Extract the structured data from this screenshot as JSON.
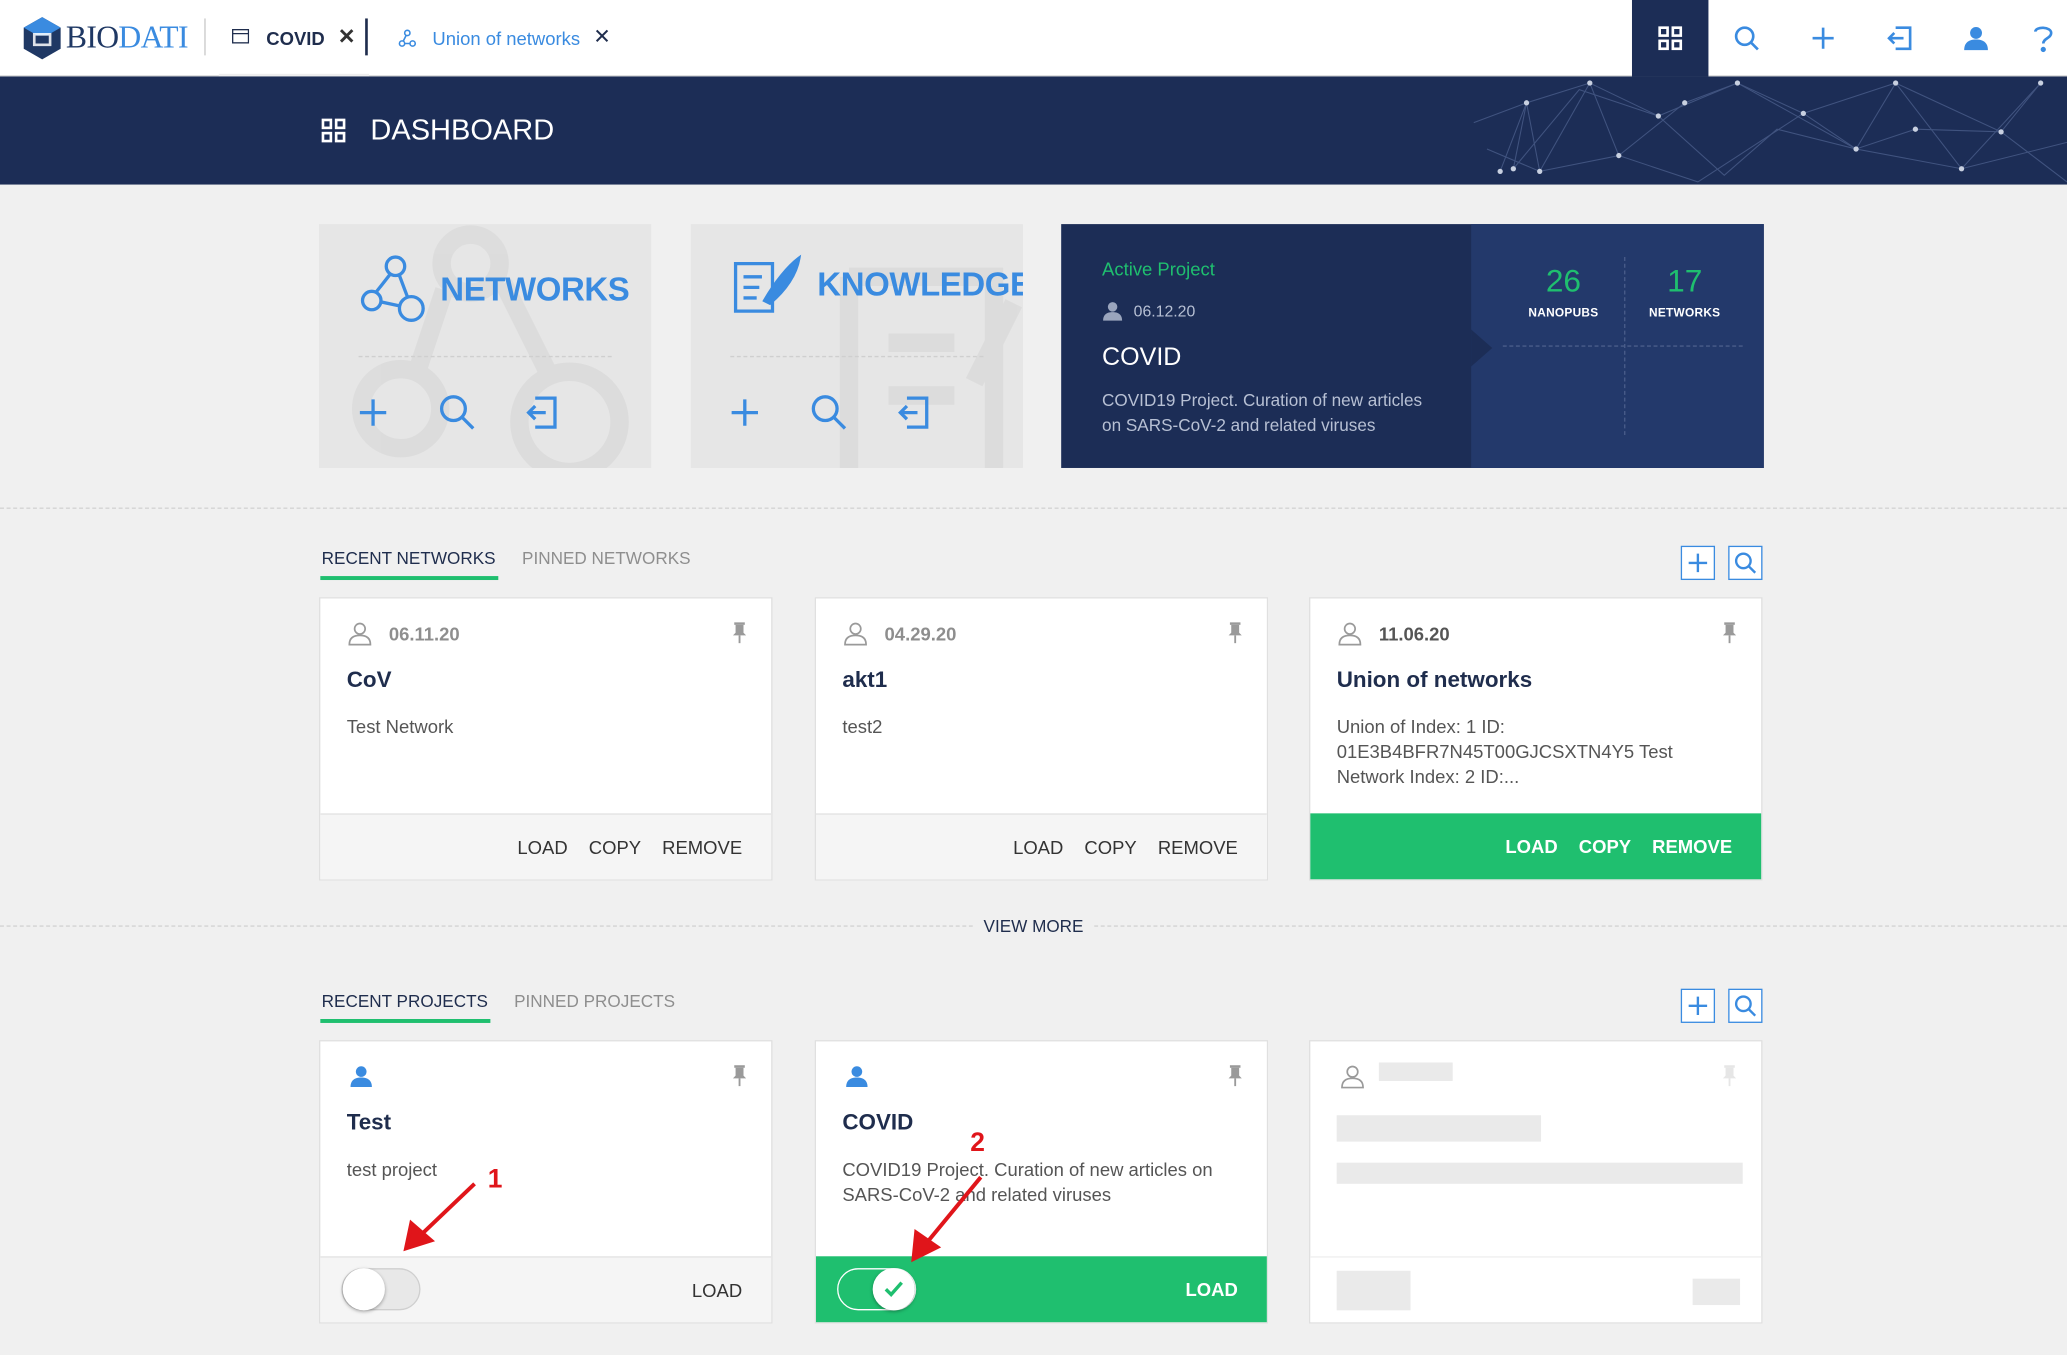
{
  "app": {
    "logo_prefix": "BIO",
    "logo_suffix": "DATI"
  },
  "tabs": [
    {
      "label": "COVID",
      "active": true
    },
    {
      "label": "Union of networks",
      "active": false
    }
  ],
  "topbar_icons": [
    "dashboard-icon",
    "search-icon",
    "add-icon",
    "import-icon",
    "user-icon",
    "help-icon"
  ],
  "header": {
    "title": "DASHBOARD"
  },
  "tiles": {
    "networks": {
      "title": "NETWORKS"
    },
    "knowledge": {
      "title": "KNOWLEDGE"
    }
  },
  "active_project": {
    "label": "Active Project",
    "date": "06.12.20",
    "name": "COVID",
    "description": "COVID19 Project. Curation of new articles on SARS-CoV-2 and related viruses",
    "nanopubs_count": "26",
    "nanopubs_label": "NANOPUBS",
    "networks_count": "17",
    "networks_label": "NETWORKS"
  },
  "networks_section": {
    "tab_recent": "RECENT NETWORKS",
    "tab_pinned": "PINNED NETWORKS",
    "view_more": "VIEW MORE",
    "cards": [
      {
        "date": "06.11.20",
        "title": "CoV",
        "description": "Test Network",
        "actions": [
          "LOAD",
          "COPY",
          "REMOVE"
        ],
        "highlighted": false
      },
      {
        "date": "04.29.20",
        "title": "akt1",
        "description": "test2",
        "actions": [
          "LOAD",
          "COPY",
          "REMOVE"
        ],
        "highlighted": false
      },
      {
        "date": "11.06.20",
        "title": "Union of networks",
        "description": "Union of Index: 1 ID: 01E3B4BFR7N45T00GJCSXTN4Y5 Test Network Index: 2 ID:...",
        "actions": [
          "LOAD",
          "COPY",
          "REMOVE"
        ],
        "highlighted": true
      }
    ]
  },
  "projects_section": {
    "tab_recent": "RECENT PROJECTS",
    "tab_pinned": "PINNED PROJECTS",
    "cards": [
      {
        "title": "Test",
        "description": "test project",
        "action": "LOAD",
        "active": false
      },
      {
        "title": "COVID",
        "description": "COVID19 Project. Curation of new articles on SARS-CoV-2 and related viruses",
        "action": "LOAD",
        "active": true
      }
    ]
  },
  "annotations": {
    "one": "1",
    "two": "2"
  },
  "colors": {
    "navy": "#1c2d56",
    "accent_blue": "#3a8be0",
    "green": "#1fbf6f",
    "annotation_red": "#e0151a"
  }
}
